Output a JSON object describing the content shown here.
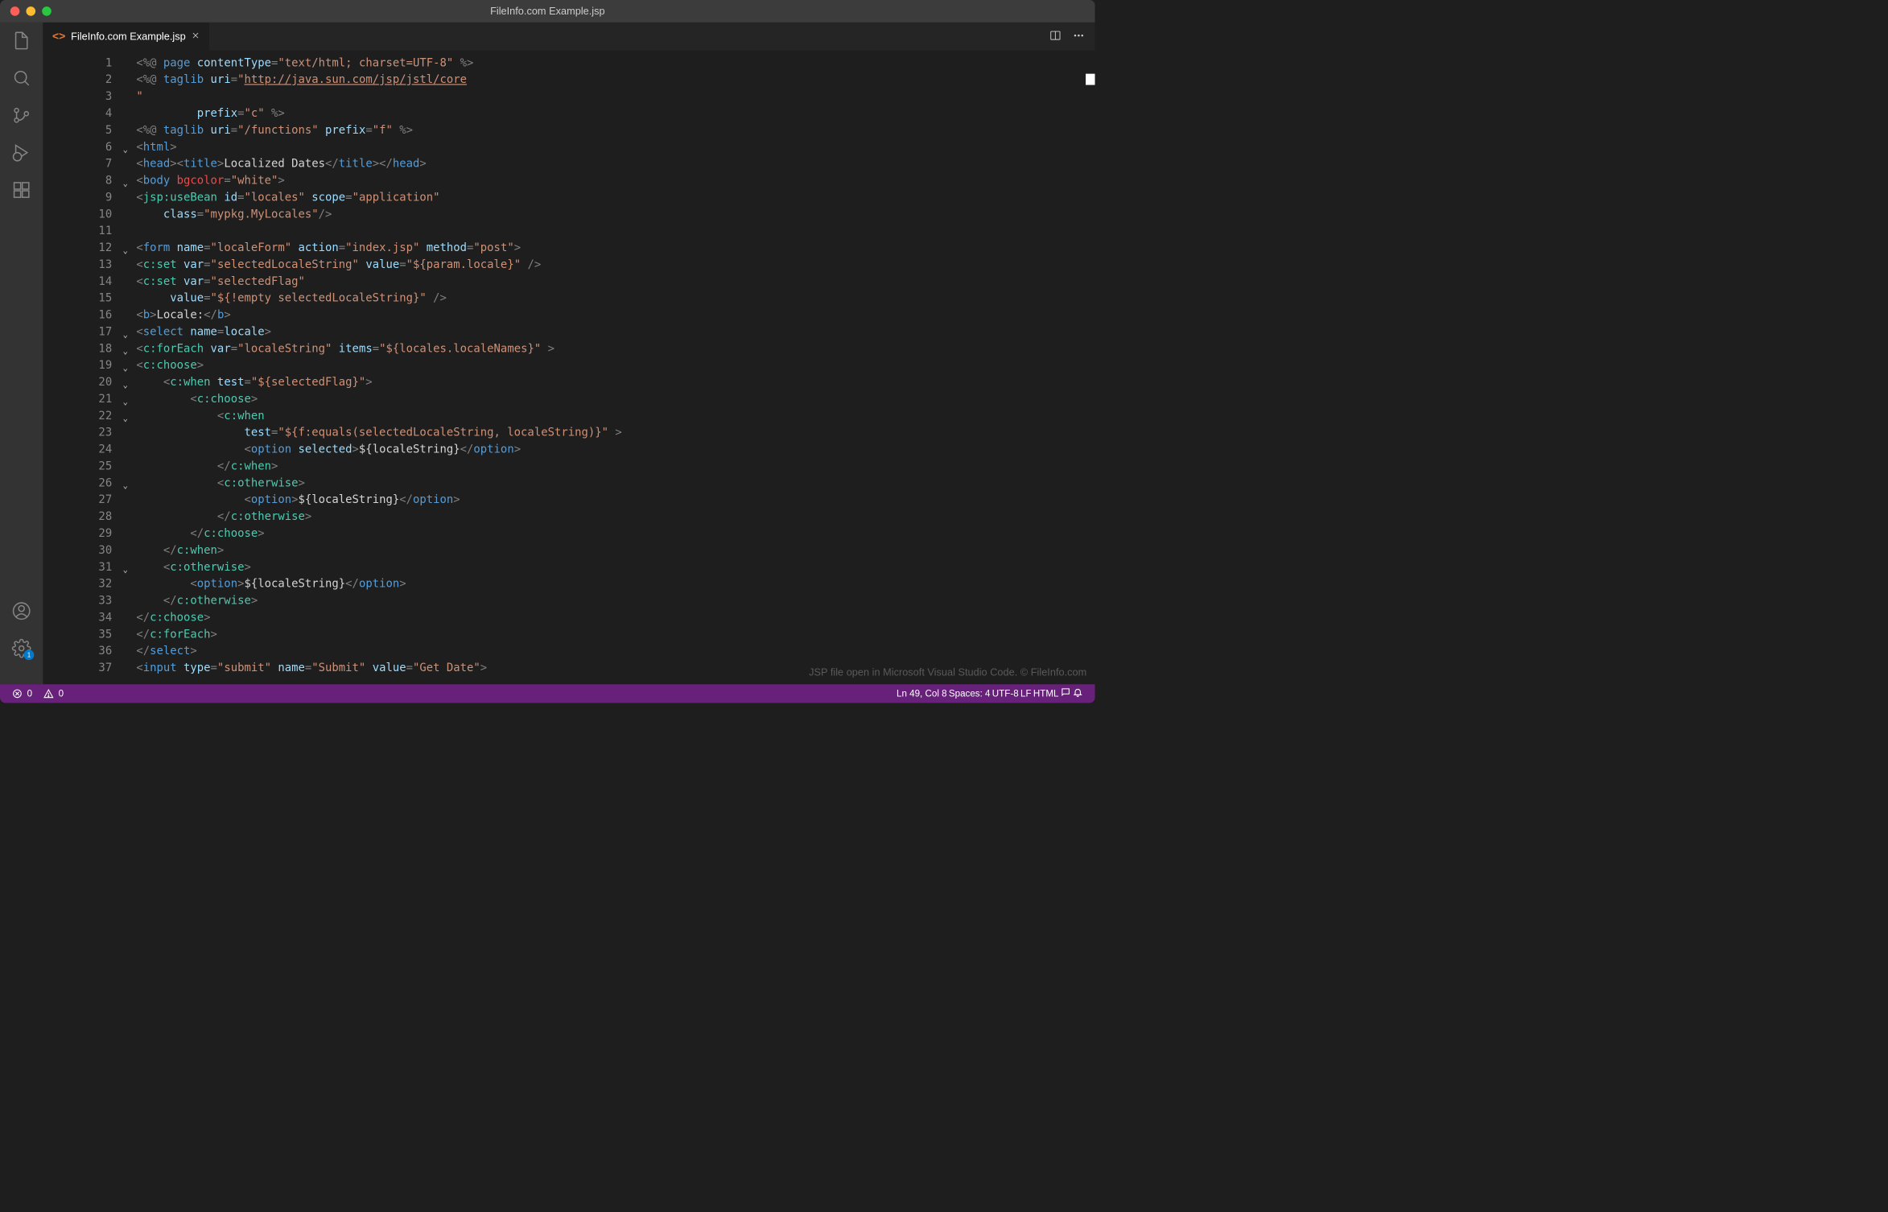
{
  "window": {
    "title": "FileInfo.com Example.jsp"
  },
  "tab": {
    "filename": "FileInfo.com Example.jsp"
  },
  "editor": {
    "watermark": "JSP file open in Microsoft Visual Studio Code. © FileInfo.com",
    "lines": [
      {
        "n": 1,
        "fold": "",
        "seg": [
          [
            "pun",
            "<%@"
          ],
          [
            "txt",
            " "
          ],
          [
            "tagn",
            "page"
          ],
          [
            "txt",
            " "
          ],
          [
            "attr",
            "contentType"
          ],
          [
            "pun",
            "="
          ],
          [
            "str",
            "\"text/html; charset=UTF-8\""
          ],
          [
            "txt",
            " "
          ],
          [
            "pun",
            "%>"
          ]
        ]
      },
      {
        "n": 2,
        "fold": "",
        "seg": [
          [
            "pun",
            "<%@"
          ],
          [
            "txt",
            " "
          ],
          [
            "tagn",
            "taglib"
          ],
          [
            "txt",
            " "
          ],
          [
            "attr",
            "uri"
          ],
          [
            "pun",
            "="
          ],
          [
            "str",
            "\""
          ],
          [
            "str underline",
            "http://java.sun.com/jsp/jstl/core"
          ]
        ]
      },
      {
        "n": 3,
        "fold": "",
        "seg": [
          [
            "str",
            "\""
          ]
        ]
      },
      {
        "n": 4,
        "fold": "",
        "seg": [
          [
            "txt",
            "         "
          ],
          [
            "attr",
            "prefix"
          ],
          [
            "pun",
            "="
          ],
          [
            "str",
            "\"c\""
          ],
          [
            "txt",
            " "
          ],
          [
            "pun",
            "%>"
          ]
        ]
      },
      {
        "n": 5,
        "fold": "",
        "seg": [
          [
            "pun",
            "<%@"
          ],
          [
            "txt",
            " "
          ],
          [
            "tagn",
            "taglib"
          ],
          [
            "txt",
            " "
          ],
          [
            "attr",
            "uri"
          ],
          [
            "pun",
            "="
          ],
          [
            "str",
            "\"/functions\""
          ],
          [
            "txt",
            " "
          ],
          [
            "attr",
            "prefix"
          ],
          [
            "pun",
            "="
          ],
          [
            "str",
            "\"f\""
          ],
          [
            "txt",
            " "
          ],
          [
            "pun",
            "%>"
          ]
        ]
      },
      {
        "n": 6,
        "fold": "v",
        "seg": [
          [
            "pun",
            "<"
          ],
          [
            "tagn",
            "html"
          ],
          [
            "pun",
            ">"
          ]
        ]
      },
      {
        "n": 7,
        "fold": "",
        "seg": [
          [
            "pun",
            "<"
          ],
          [
            "tagn",
            "head"
          ],
          [
            "pun",
            "><"
          ],
          [
            "tagn",
            "title"
          ],
          [
            "pun",
            ">"
          ],
          [
            "txt",
            "Localized Dates"
          ],
          [
            "pun",
            "</"
          ],
          [
            "tagn",
            "title"
          ],
          [
            "pun",
            "></"
          ],
          [
            "tagn",
            "head"
          ],
          [
            "pun",
            ">"
          ]
        ]
      },
      {
        "n": 8,
        "fold": "v",
        "seg": [
          [
            "pun",
            "<"
          ],
          [
            "tagn",
            "body"
          ],
          [
            "txt",
            " "
          ],
          [
            "attrd",
            "bgcolor"
          ],
          [
            "pun",
            "="
          ],
          [
            "str",
            "\"white\""
          ],
          [
            "pun",
            ">"
          ]
        ]
      },
      {
        "n": 9,
        "fold": "",
        "seg": [
          [
            "pun",
            "<"
          ],
          [
            "nsx",
            "jsp:useBean"
          ],
          [
            "txt",
            " "
          ],
          [
            "attr",
            "id"
          ],
          [
            "pun",
            "="
          ],
          [
            "str",
            "\"locales\""
          ],
          [
            "txt",
            " "
          ],
          [
            "attr",
            "scope"
          ],
          [
            "pun",
            "="
          ],
          [
            "str",
            "\"application\""
          ]
        ]
      },
      {
        "n": 10,
        "fold": "",
        "seg": [
          [
            "txt",
            "    "
          ],
          [
            "attr",
            "class"
          ],
          [
            "pun",
            "="
          ],
          [
            "str",
            "\"mypkg.MyLocales\""
          ],
          [
            "pun",
            "/>"
          ]
        ]
      },
      {
        "n": 11,
        "fold": "",
        "seg": [
          [
            "txt",
            " "
          ]
        ]
      },
      {
        "n": 12,
        "fold": "v",
        "seg": [
          [
            "pun",
            "<"
          ],
          [
            "tagn",
            "form"
          ],
          [
            "txt",
            " "
          ],
          [
            "attr",
            "name"
          ],
          [
            "pun",
            "="
          ],
          [
            "str",
            "\"localeForm\""
          ],
          [
            "txt",
            " "
          ],
          [
            "attr",
            "action"
          ],
          [
            "pun",
            "="
          ],
          [
            "str",
            "\"index.jsp\""
          ],
          [
            "txt",
            " "
          ],
          [
            "attr",
            "method"
          ],
          [
            "pun",
            "="
          ],
          [
            "str",
            "\"post\""
          ],
          [
            "pun",
            ">"
          ]
        ]
      },
      {
        "n": 13,
        "fold": "",
        "seg": [
          [
            "pun",
            "<"
          ],
          [
            "nsx",
            "c:set"
          ],
          [
            "txt",
            " "
          ],
          [
            "attr",
            "var"
          ],
          [
            "pun",
            "="
          ],
          [
            "str",
            "\"selectedLocaleString\""
          ],
          [
            "txt",
            " "
          ],
          [
            "attr",
            "value"
          ],
          [
            "pun",
            "="
          ],
          [
            "str",
            "\"${param.locale}\""
          ],
          [
            "txt",
            " "
          ],
          [
            "pun",
            "/>"
          ]
        ]
      },
      {
        "n": 14,
        "fold": "",
        "seg": [
          [
            "pun",
            "<"
          ],
          [
            "nsx",
            "c:set"
          ],
          [
            "txt",
            " "
          ],
          [
            "attr",
            "var"
          ],
          [
            "pun",
            "="
          ],
          [
            "str",
            "\"selectedFlag\""
          ]
        ]
      },
      {
        "n": 15,
        "fold": "",
        "seg": [
          [
            "txt",
            "     "
          ],
          [
            "attr",
            "value"
          ],
          [
            "pun",
            "="
          ],
          [
            "str",
            "\"${!empty selectedLocaleString}\""
          ],
          [
            "txt",
            " "
          ],
          [
            "pun",
            "/>"
          ]
        ]
      },
      {
        "n": 16,
        "fold": "",
        "seg": [
          [
            "pun",
            "<"
          ],
          [
            "tagn",
            "b"
          ],
          [
            "pun",
            ">"
          ],
          [
            "txt",
            "Locale:"
          ],
          [
            "pun",
            "</"
          ],
          [
            "tagn",
            "b"
          ],
          [
            "pun",
            ">"
          ]
        ]
      },
      {
        "n": 17,
        "fold": "v",
        "seg": [
          [
            "pun",
            "<"
          ],
          [
            "tagn",
            "select"
          ],
          [
            "txt",
            " "
          ],
          [
            "attr",
            "name"
          ],
          [
            "pun",
            "="
          ],
          [
            "attr",
            "locale"
          ],
          [
            "pun",
            ">"
          ]
        ]
      },
      {
        "n": 18,
        "fold": "v",
        "seg": [
          [
            "pun",
            "<"
          ],
          [
            "nsx",
            "c:forEach"
          ],
          [
            "txt",
            " "
          ],
          [
            "attr",
            "var"
          ],
          [
            "pun",
            "="
          ],
          [
            "str",
            "\"localeString\""
          ],
          [
            "txt",
            " "
          ],
          [
            "attr",
            "items"
          ],
          [
            "pun",
            "="
          ],
          [
            "str",
            "\"${locales.localeNames}\""
          ],
          [
            "txt",
            " "
          ],
          [
            "pun",
            ">"
          ]
        ]
      },
      {
        "n": 19,
        "fold": "v",
        "seg": [
          [
            "pun",
            "<"
          ],
          [
            "nsx",
            "c:choose"
          ],
          [
            "pun",
            ">"
          ]
        ]
      },
      {
        "n": 20,
        "fold": "v",
        "seg": [
          [
            "txt",
            "    "
          ],
          [
            "pun",
            "<"
          ],
          [
            "nsx",
            "c:when"
          ],
          [
            "txt",
            " "
          ],
          [
            "attr",
            "test"
          ],
          [
            "pun",
            "="
          ],
          [
            "str",
            "\"${selectedFlag}\""
          ],
          [
            "pun",
            ">"
          ]
        ]
      },
      {
        "n": 21,
        "fold": "v",
        "seg": [
          [
            "txt",
            "        "
          ],
          [
            "pun",
            "<"
          ],
          [
            "nsx",
            "c:choose"
          ],
          [
            "pun",
            ">"
          ]
        ]
      },
      {
        "n": 22,
        "fold": "v",
        "seg": [
          [
            "txt",
            "            "
          ],
          [
            "pun",
            "<"
          ],
          [
            "nsx",
            "c:when"
          ]
        ]
      },
      {
        "n": 23,
        "fold": "",
        "seg": [
          [
            "txt",
            "                "
          ],
          [
            "attr",
            "test"
          ],
          [
            "pun",
            "="
          ],
          [
            "str",
            "\"${f:equals(selectedLocaleString, localeString)}\""
          ],
          [
            "txt",
            " "
          ],
          [
            "pun",
            ">"
          ]
        ]
      },
      {
        "n": 24,
        "fold": "",
        "seg": [
          [
            "txt",
            "                "
          ],
          [
            "pun",
            "<"
          ],
          [
            "tagn",
            "option"
          ],
          [
            "txt",
            " "
          ],
          [
            "attr",
            "selected"
          ],
          [
            "pun",
            ">"
          ],
          [
            "txt",
            "${localeString}"
          ],
          [
            "pun",
            "</"
          ],
          [
            "tagn",
            "option"
          ],
          [
            "pun",
            ">"
          ]
        ]
      },
      {
        "n": 25,
        "fold": "",
        "seg": [
          [
            "txt",
            "            "
          ],
          [
            "pun",
            "</"
          ],
          [
            "nsx",
            "c:when"
          ],
          [
            "pun",
            ">"
          ]
        ]
      },
      {
        "n": 26,
        "fold": "v",
        "seg": [
          [
            "txt",
            "            "
          ],
          [
            "pun",
            "<"
          ],
          [
            "nsx",
            "c:otherwise"
          ],
          [
            "pun",
            ">"
          ]
        ]
      },
      {
        "n": 27,
        "fold": "",
        "seg": [
          [
            "txt",
            "                "
          ],
          [
            "pun",
            "<"
          ],
          [
            "tagn",
            "option"
          ],
          [
            "pun",
            ">"
          ],
          [
            "txt",
            "${localeString}"
          ],
          [
            "pun",
            "</"
          ],
          [
            "tagn",
            "option"
          ],
          [
            "pun",
            ">"
          ]
        ]
      },
      {
        "n": 28,
        "fold": "",
        "seg": [
          [
            "txt",
            "            "
          ],
          [
            "pun",
            "</"
          ],
          [
            "nsx",
            "c:otherwise"
          ],
          [
            "pun",
            ">"
          ]
        ]
      },
      {
        "n": 29,
        "fold": "",
        "seg": [
          [
            "txt",
            "        "
          ],
          [
            "pun",
            "</"
          ],
          [
            "nsx",
            "c:choose"
          ],
          [
            "pun",
            ">"
          ]
        ]
      },
      {
        "n": 30,
        "fold": "",
        "seg": [
          [
            "txt",
            "    "
          ],
          [
            "pun",
            "</"
          ],
          [
            "nsx",
            "c:when"
          ],
          [
            "pun",
            ">"
          ]
        ]
      },
      {
        "n": 31,
        "fold": "v",
        "seg": [
          [
            "txt",
            "    "
          ],
          [
            "pun",
            "<"
          ],
          [
            "nsx",
            "c:otherwise"
          ],
          [
            "pun",
            ">"
          ]
        ]
      },
      {
        "n": 32,
        "fold": "",
        "seg": [
          [
            "txt",
            "        "
          ],
          [
            "pun",
            "<"
          ],
          [
            "tagn",
            "option"
          ],
          [
            "pun",
            ">"
          ],
          [
            "txt",
            "${localeString}"
          ],
          [
            "pun",
            "</"
          ],
          [
            "tagn",
            "option"
          ],
          [
            "pun",
            ">"
          ]
        ]
      },
      {
        "n": 33,
        "fold": "",
        "seg": [
          [
            "txt",
            "    "
          ],
          [
            "pun",
            "</"
          ],
          [
            "nsx",
            "c:otherwise"
          ],
          [
            "pun",
            ">"
          ]
        ]
      },
      {
        "n": 34,
        "fold": "",
        "seg": [
          [
            "pun",
            "</"
          ],
          [
            "nsx",
            "c:choose"
          ],
          [
            "pun",
            ">"
          ]
        ]
      },
      {
        "n": 35,
        "fold": "",
        "seg": [
          [
            "pun",
            "</"
          ],
          [
            "nsx",
            "c:forEach"
          ],
          [
            "pun",
            ">"
          ]
        ]
      },
      {
        "n": 36,
        "fold": "",
        "seg": [
          [
            "pun",
            "</"
          ],
          [
            "tagn",
            "select"
          ],
          [
            "pun",
            ">"
          ]
        ]
      },
      {
        "n": 37,
        "fold": "",
        "seg": [
          [
            "pun",
            "<"
          ],
          [
            "tagn",
            "input"
          ],
          [
            "txt",
            " "
          ],
          [
            "attr",
            "type"
          ],
          [
            "pun",
            "="
          ],
          [
            "str",
            "\"submit\""
          ],
          [
            "txt",
            " "
          ],
          [
            "attr",
            "name"
          ],
          [
            "pun",
            "="
          ],
          [
            "str",
            "\"Submit\""
          ],
          [
            "txt",
            " "
          ],
          [
            "attr",
            "value"
          ],
          [
            "pun",
            "="
          ],
          [
            "str",
            "\"Get Date\""
          ],
          [
            "pun",
            ">"
          ]
        ]
      }
    ]
  },
  "statusbar": {
    "errors": "0",
    "warnings": "0",
    "cursor": "Ln 49, Col 8",
    "indent": "Spaces: 4",
    "encoding": "UTF-8",
    "eol": "LF",
    "language": "HTML"
  },
  "settingsBadge": "1"
}
